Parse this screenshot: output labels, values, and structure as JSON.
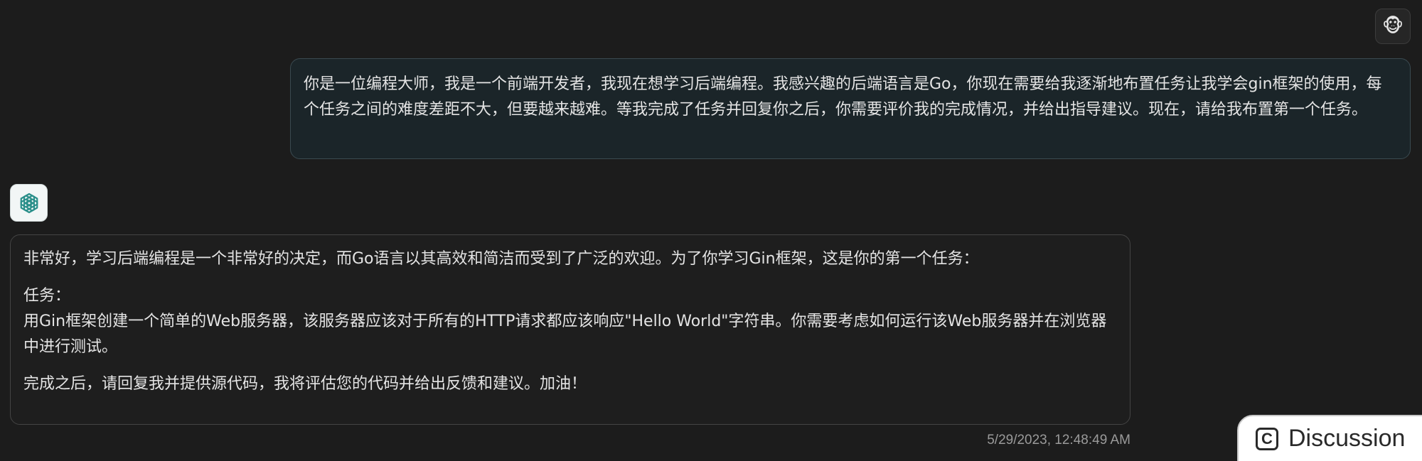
{
  "user_message": {
    "avatar_icon": "monkey-face-icon",
    "avatar_glyph": "🐵",
    "text": "你是一位编程大师，我是一个前端开发者，我现在想学习后端编程。我感兴趣的后端语言是Go，你现在需要给我逐渐地布置任务让我学会gin框架的使用，每个任务之间的难度差距不大，但要越来越难。等我完成了任务并回复你之后，你需要评价我的完成情况，并给出指导建议。现在，请给我布置第一个任务。"
  },
  "assistant_message": {
    "avatar_icon": "openai-logo-icon",
    "paragraph_1": "非常好，学习后端编程是一个非常好的决定，而Go语言以其高效和简洁而受到了广泛的欢迎。为了你学习Gin框架，这是你的第一个任务：",
    "task_label": "任务：",
    "task_body": "用Gin框架创建一个简单的Web服务器，该服务器应该对于所有的HTTP请求都应该响应\"Hello World\"字符串。你需要考虑如何运行该Web服务器并在浏览器中进行测试。",
    "paragraph_3": "完成之后，请回复我并提供源代码，我将评估您的代码并给出反馈和建议。加油！",
    "timestamp": "5/29/2023, 12:48:49 AM"
  },
  "discussion_tab": {
    "icon": "c-box-icon",
    "icon_glyph": "C",
    "label": "Discussion"
  },
  "colors": {
    "background": "#1c1c1c",
    "user_bubble": "#1b2529",
    "assistant_logo": "#2a8f8a"
  }
}
